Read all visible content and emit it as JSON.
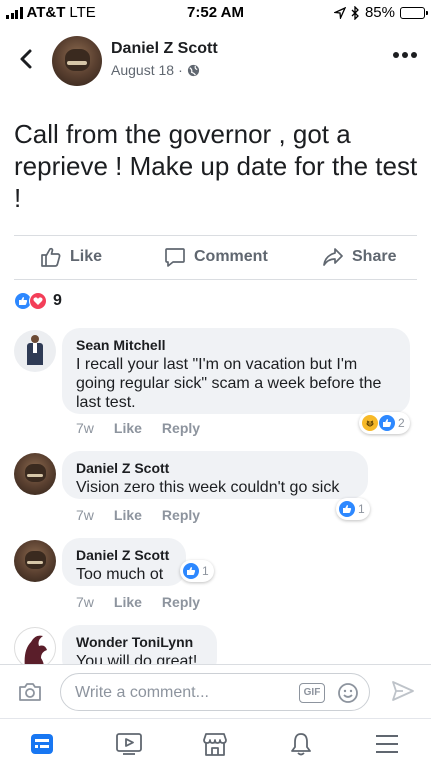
{
  "status_bar": {
    "carrier": "AT&T",
    "network": "LTE",
    "time": "7:52 AM",
    "battery": "85%",
    "battery_level": 0.85
  },
  "post": {
    "author": "Daniel Z Scott",
    "date": "August 18",
    "privacy_icon": "globe-icon",
    "text": "Call from the governor , got a reprieve ! Make up date for the test !"
  },
  "actions": {
    "like": "Like",
    "comment": "Comment",
    "share": "Share"
  },
  "reactions": {
    "count": "9"
  },
  "comments": [
    {
      "name": "Sean Mitchell",
      "text": "I recall your last \"I'm on vacation but I'm going regular sick\" scam a week before the last test.",
      "time": "7w",
      "like": "Like",
      "reply": "Reply",
      "reaction_count": "2"
    },
    {
      "name": "Daniel Z Scott",
      "text": "Vision zero this week couldn't go sick",
      "time": "7w",
      "like": "Like",
      "reply": "Reply",
      "reaction_count": "1"
    },
    {
      "name": "Daniel Z Scott",
      "text": "Too much ot",
      "time": "7w",
      "like": "Like",
      "reply": "Reply",
      "reaction_count": "1"
    },
    {
      "name": "Wonder ToniLynn",
      "text": "You will do great!"
    }
  ],
  "composer": {
    "placeholder": "Write a comment...",
    "gif_label": "GIF"
  },
  "colors": {
    "accent": "#1877f2",
    "like_blue": "#2d88ff",
    "love_red": "#f33e58",
    "muted": "#606770"
  }
}
